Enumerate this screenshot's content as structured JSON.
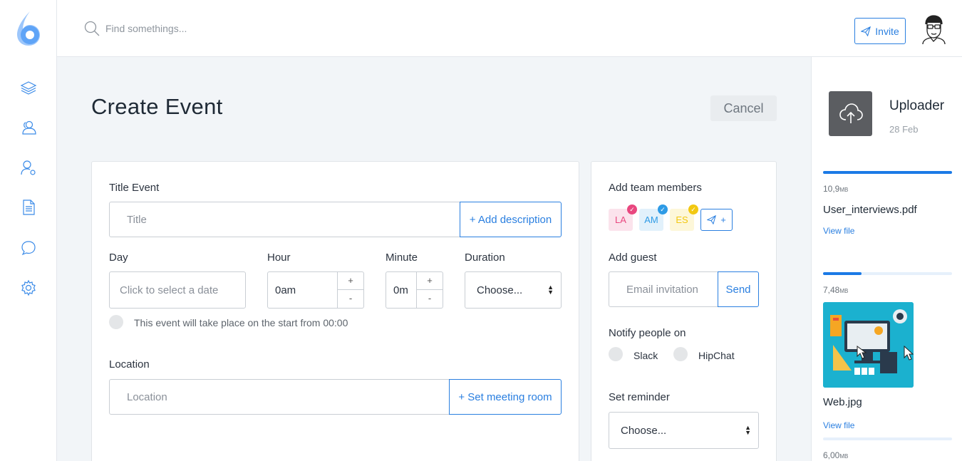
{
  "topbar": {
    "search_placeholder": "Find somethings...",
    "invite_label": "Invite"
  },
  "sidebar": {
    "items": [
      {
        "icon": "layers-icon"
      },
      {
        "icon": "users-icon"
      },
      {
        "icon": "user-settings-icon"
      },
      {
        "icon": "document-icon"
      },
      {
        "icon": "chat-icon"
      },
      {
        "icon": "gear-icon"
      }
    ]
  },
  "page": {
    "title": "Create Event",
    "cancel_label": "Cancel"
  },
  "form": {
    "title_label": "Title Event",
    "title_placeholder": "Title",
    "add_description": "+ Add description",
    "day_label": "Day",
    "day_placeholder": "Click to select a date",
    "hour_label": "Hour",
    "hour_value": "0am",
    "minute_label": "Minute",
    "minute_value": "0m",
    "duration_label": "Duration",
    "duration_value": "Choose...",
    "plus": "+",
    "minus": "-",
    "event_note": "This event will take place on the start from 00:00",
    "location_label": "Location",
    "location_placeholder": "Location",
    "set_meeting_room": "+ Set meeting room"
  },
  "side_form": {
    "team_label": "Add team members",
    "members": [
      {
        "initials": "LA",
        "color": "#e9477f",
        "bg": "#fbe3ec"
      },
      {
        "initials": "AM",
        "color": "#2e9be6",
        "bg": "#e2f1fb"
      },
      {
        "initials": "ES",
        "color": "#f2c811",
        "bg": "#fdf7d9"
      }
    ],
    "add_member_plus": "+",
    "guest_label": "Add guest",
    "guest_placeholder": "Email invitation",
    "send_label": "Send",
    "notify_label": "Notify people on",
    "notify_options": [
      "Slack",
      "HipChat"
    ],
    "reminder_label": "Set reminder",
    "reminder_value": "Choose..."
  },
  "uploader": {
    "title": "Uploader",
    "date": "28 Feb",
    "files": [
      {
        "size": "10,9",
        "unit": "MB",
        "name": "User_interviews.pdf",
        "link": "View file",
        "progress": 1.0
      },
      {
        "size": "7,48",
        "unit": "MB",
        "name": "Web.jpg",
        "link": "View file",
        "progress": 0.3
      },
      {
        "size": "6,00",
        "unit": "MB",
        "progress": 0.0
      }
    ]
  },
  "colors": {
    "accent": "#2a7fe0",
    "progress": "#1b7ae6",
    "uploader_tile": "#5b5d61"
  }
}
